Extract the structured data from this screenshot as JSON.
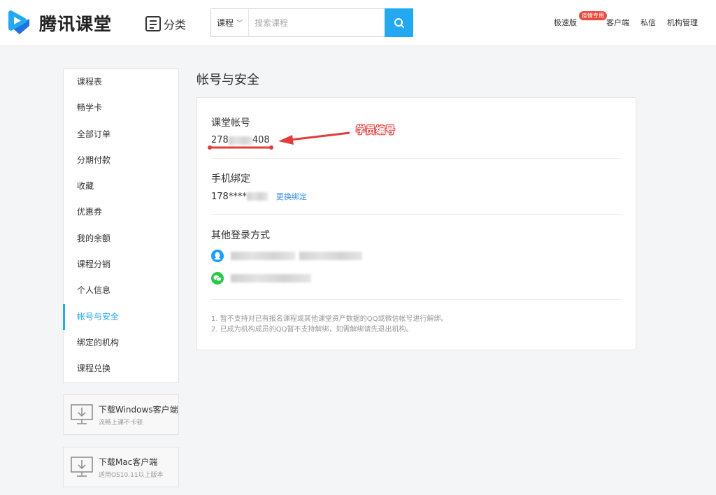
{
  "header": {
    "logo_text": "腾讯课堂",
    "category_label": "分类",
    "search_type": "课程",
    "search_placeholder": "搜索课程",
    "nav": {
      "fast_version": "极速版",
      "fast_badge": "疫情专用",
      "client": "客户端",
      "messages": "私信",
      "org_manage": "机构管理"
    }
  },
  "sidebar": {
    "items": [
      {
        "label": "课程表"
      },
      {
        "label": "畅学卡"
      },
      {
        "label": "全部订单"
      },
      {
        "label": "分期付款"
      },
      {
        "label": "收藏"
      },
      {
        "label": "优惠券"
      },
      {
        "label": "我的余额"
      },
      {
        "label": "课程分销"
      },
      {
        "label": "个人信息"
      },
      {
        "label": "帐号与安全",
        "active": true
      },
      {
        "label": "绑定的机构"
      },
      {
        "label": "课程兑换"
      }
    ],
    "downloads": [
      {
        "title": "下载Windows客户端",
        "subtitle": "流畅上课不卡顿"
      },
      {
        "title": "下载Mac客户端",
        "subtitle": "适用OS10.11以上版本"
      }
    ]
  },
  "main": {
    "title": "帐号与安全",
    "account": {
      "label": "课堂帐号",
      "value_prefix": "278",
      "value_suffix": "408"
    },
    "phone": {
      "label": "手机绑定",
      "value_prefix": "178****",
      "change_link": "更换绑定"
    },
    "other_login": {
      "label": "其他登录方式",
      "methods": [
        {
          "type": "qq-icon"
        },
        {
          "type": "wechat-icon"
        }
      ]
    },
    "notes": [
      "1. 暂不支持对已有报名课程或其他课堂资产数据的QQ或微信帐号进行解绑。",
      "2. 已成为机构成员的QQ暂不支持解绑，如需解绑请先退出机构。"
    ],
    "annotation": "学员编号"
  },
  "colors": {
    "accent": "#23a9f2",
    "link": "#3a8ee6",
    "annotation": "#e03d3d",
    "badge": "#e94b3c"
  }
}
